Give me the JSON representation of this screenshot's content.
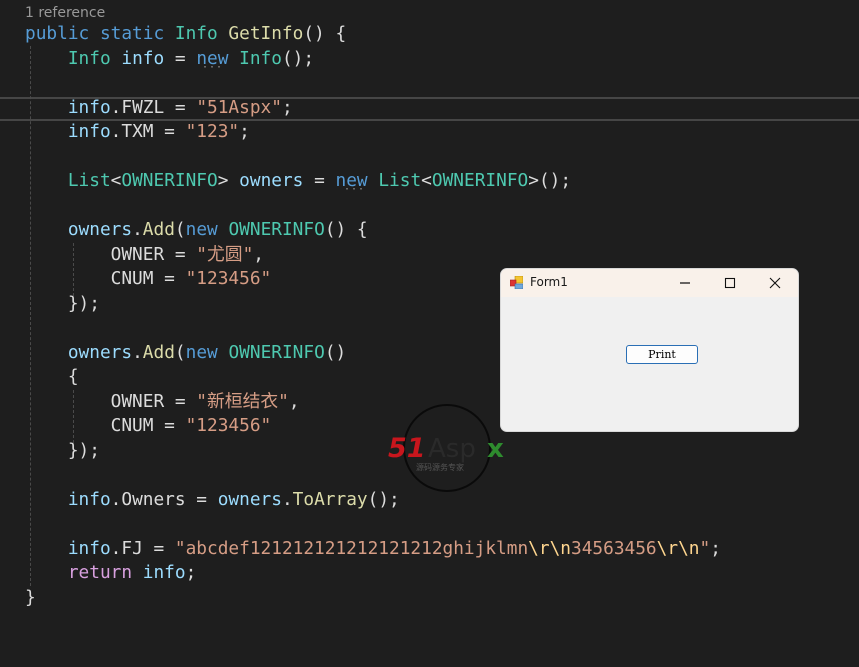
{
  "editor": {
    "codelens": "1 reference",
    "lines": [
      [
        [
          "public ",
          "kw"
        ],
        [
          "static ",
          "kw"
        ],
        [
          "Info ",
          "ty"
        ],
        [
          "GetInfo",
          "fn"
        ],
        [
          "() {",
          "pl"
        ]
      ],
      [
        [
          "    ",
          "pl"
        ],
        [
          "Info ",
          "ty"
        ],
        [
          "info",
          "va"
        ],
        [
          " = ",
          "pl"
        ],
        [
          "new ",
          "kw"
        ],
        [
          "Info",
          "ty"
        ],
        [
          "();",
          "pl"
        ]
      ],
      [],
      [
        [
          "    ",
          "pl"
        ],
        [
          "info",
          "va"
        ],
        [
          ".FWZL = ",
          "pl"
        ],
        [
          "\"51Aspx\"",
          "st"
        ],
        [
          ";",
          "pl"
        ]
      ],
      [
        [
          "    ",
          "pl"
        ],
        [
          "info",
          "va"
        ],
        [
          ".TXM = ",
          "pl"
        ],
        [
          "\"123\"",
          "st"
        ],
        [
          ";",
          "pl"
        ]
      ],
      [],
      [
        [
          "    ",
          "pl"
        ],
        [
          "List",
          "ty"
        ],
        [
          "<",
          "pl"
        ],
        [
          "OWNERINFO",
          "ty"
        ],
        [
          "> ",
          "pl"
        ],
        [
          "owners",
          "va"
        ],
        [
          " = ",
          "pl"
        ],
        [
          "new ",
          "kw"
        ],
        [
          "List",
          "ty"
        ],
        [
          "<",
          "pl"
        ],
        [
          "OWNERINFO",
          "ty"
        ],
        [
          ">();",
          "pl"
        ]
      ],
      [],
      [
        [
          "    ",
          "pl"
        ],
        [
          "owners",
          "va"
        ],
        [
          ".",
          "pl"
        ],
        [
          "Add",
          "fn"
        ],
        [
          "(",
          "pl"
        ],
        [
          "new ",
          "kw"
        ],
        [
          "OWNERINFO",
          "ty"
        ],
        [
          "() {",
          "pl"
        ]
      ],
      [
        [
          "        OWNER = ",
          "pl"
        ],
        [
          "\"尤圆\"",
          "st"
        ],
        [
          ",",
          "pl"
        ]
      ],
      [
        [
          "        CNUM = ",
          "pl"
        ],
        [
          "\"123456\"",
          "st"
        ]
      ],
      [
        [
          "    });",
          "pl"
        ]
      ],
      [],
      [
        [
          "    ",
          "pl"
        ],
        [
          "owners",
          "va"
        ],
        [
          ".",
          "pl"
        ],
        [
          "Add",
          "fn"
        ],
        [
          "(",
          "pl"
        ],
        [
          "new ",
          "kw"
        ],
        [
          "OWNERINFO",
          "ty"
        ],
        [
          "()",
          "pl"
        ]
      ],
      [
        [
          "    {",
          "pl"
        ]
      ],
      [
        [
          "        OWNER = ",
          "pl"
        ],
        [
          "\"新桓结衣\"",
          "st"
        ],
        [
          ",",
          "pl"
        ]
      ],
      [
        [
          "        CNUM = ",
          "pl"
        ],
        [
          "\"123456\"",
          "st"
        ]
      ],
      [
        [
          "    });",
          "pl"
        ]
      ],
      [],
      [
        [
          "    ",
          "pl"
        ],
        [
          "info",
          "va"
        ],
        [
          ".Owners = ",
          "pl"
        ],
        [
          "owners",
          "va"
        ],
        [
          ".",
          "pl"
        ],
        [
          "ToArray",
          "fn"
        ],
        [
          "();",
          "pl"
        ]
      ],
      [],
      [
        [
          "    ",
          "pl"
        ],
        [
          "info",
          "va"
        ],
        [
          ".FJ = ",
          "pl"
        ],
        [
          "\"abcdef121212121212121212ghijklmn",
          "st"
        ],
        [
          "\\r\\n",
          "es"
        ],
        [
          "34563456",
          "st"
        ],
        [
          "\\r\\n",
          "es"
        ],
        [
          "\"",
          "st"
        ],
        [
          ";",
          "pl"
        ]
      ],
      [
        [
          "    ",
          "pl"
        ],
        [
          "return ",
          "rt"
        ],
        [
          "info",
          "va"
        ],
        [
          ";",
          "pl"
        ]
      ],
      [
        [
          "}",
          "pl"
        ]
      ]
    ]
  },
  "form": {
    "title": "Form1",
    "print_label": "Print",
    "minimize_icon": "minimize-icon",
    "maximize_icon": "maximize-icon",
    "close_icon": "close-icon"
  },
  "watermark": {
    "brand": "51Aspx",
    "subtitle": "源码源务专家"
  },
  "colors": {
    "keyword": "#569cd6",
    "type": "#4ec9b0",
    "method": "#dcdcaa",
    "variable": "#9cdcfe",
    "string": "#d69d85",
    "escape": "#ffd68f",
    "control": "#d8a0df",
    "background": "#1e1e1e"
  }
}
